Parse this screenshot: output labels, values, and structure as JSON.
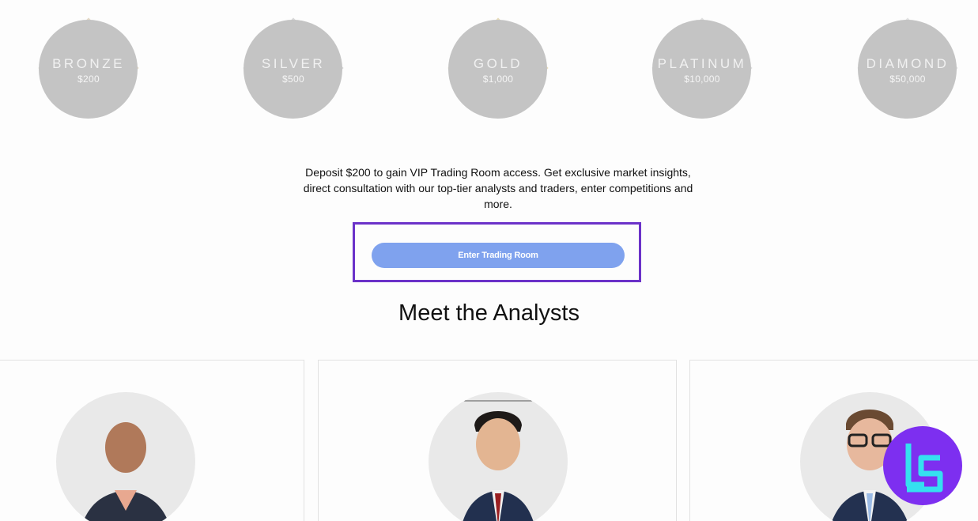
{
  "tiers": [
    {
      "name": "BRONZE",
      "amount": "$200",
      "frame_color": "#e4d9c6"
    },
    {
      "name": "SILVER",
      "amount": "$500",
      "frame_color": "#d8d8d8"
    },
    {
      "name": "GOLD",
      "amount": "$1,000",
      "frame_color": "#e6dcbb"
    },
    {
      "name": "PLATINUM",
      "amount": "$10,000",
      "frame_color": "#dedede"
    },
    {
      "name": "DIAMOND",
      "amount": "$50,000",
      "frame_color": "#e2e2e2"
    }
  ],
  "description": "Deposit $200 to gain VIP Trading Room access. Get exclusive market insights, direct consultation with our top-tier analysts and traders, enter competitions and more.",
  "enter_button_label": "Enter Trading Room",
  "section_title": "Meet the Analysts",
  "colors": {
    "button": "#7fa2ee",
    "highlight": "#6b32c9",
    "circle": "#c4c4c4",
    "badge": "#7d2ff0",
    "badge_mark": "#35e0f0"
  },
  "analysts": [
    {
      "icon": "analyst-photo"
    },
    {
      "icon": "analyst-photo"
    },
    {
      "icon": "analyst-photo"
    }
  ],
  "badge_icon": "tc-logo-icon"
}
